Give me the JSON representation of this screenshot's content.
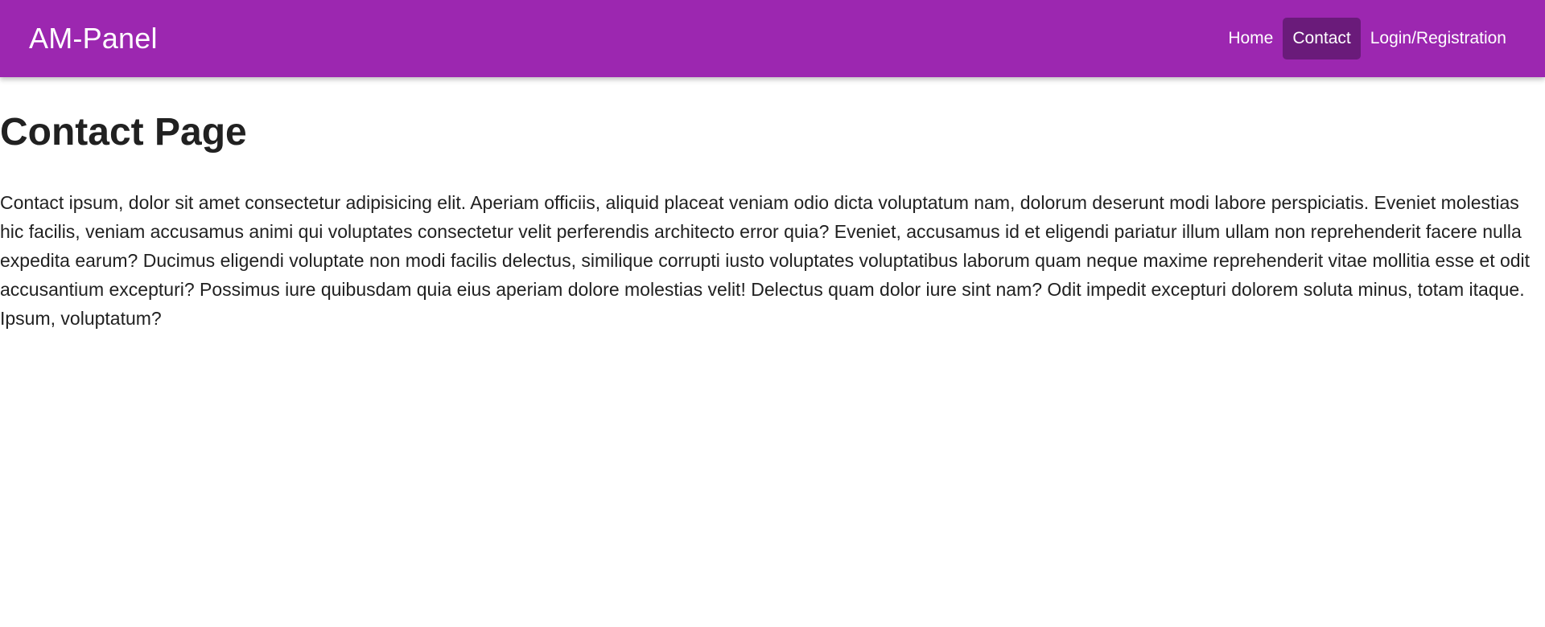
{
  "navbar": {
    "brand": "AM-Panel",
    "links": [
      {
        "label": "Home",
        "active": false
      },
      {
        "label": "Contact",
        "active": true
      },
      {
        "label": "Login/Registration",
        "active": false
      }
    ]
  },
  "main": {
    "title": "Contact Page",
    "paragraph": "Contact ipsum, dolor sit amet consectetur adipisicing elit. Aperiam officiis, aliquid placeat veniam odio dicta voluptatum nam, dolorum deserunt modi labore perspiciatis. Eveniet molestias hic facilis, veniam accusamus animi qui voluptates consectetur velit perferendis architecto error quia? Eveniet, accusamus id et eligendi pariatur illum ullam non reprehenderit facere nulla expedita earum? Ducimus eligendi voluptate non modi facilis delectus, similique corrupti iusto voluptates voluptatibus laborum quam neque maxime reprehenderit vitae mollitia esse et odit accusantium excepturi? Possimus iure quibusdam quia eius aperiam dolore molestias velit! Delectus quam dolor iure sint nam? Odit impedit excepturi dolorem soluta minus, totam itaque. Ipsum, voluptatum?"
  },
  "colors": {
    "navbar_bg": "#9c27b0",
    "active_link_bg": "#6a1b7a",
    "text": "#212121"
  }
}
